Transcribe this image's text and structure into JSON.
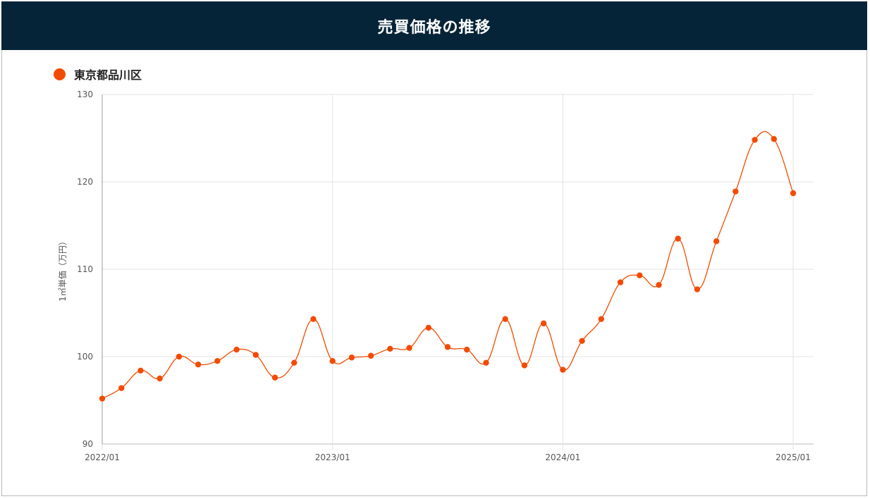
{
  "header": {
    "title": "売買価格の推移"
  },
  "colors": {
    "header_bg": "#062437",
    "series": "#f24b00"
  },
  "chart_data": {
    "type": "line",
    "title": "売買価格の推移",
    "ylabel": "1㎡単価（万円）",
    "xlabel": "",
    "ylim": [
      90,
      130
    ],
    "yticks": [
      90,
      100,
      110,
      120,
      130
    ],
    "xticks": [
      {
        "index": 0,
        "label": "2022/01"
      },
      {
        "index": 12,
        "label": "2023/01"
      },
      {
        "index": 24,
        "label": "2024/01"
      },
      {
        "index": 36,
        "label": "2025/01"
      }
    ],
    "grid": true,
    "legend_position": "top-left",
    "x": [
      "2022/01",
      "2022/02",
      "2022/03",
      "2022/04",
      "2022/05",
      "2022/06",
      "2022/07",
      "2022/08",
      "2022/09",
      "2022/10",
      "2022/11",
      "2022/12",
      "2023/01",
      "2023/02",
      "2023/03",
      "2023/04",
      "2023/05",
      "2023/06",
      "2023/07",
      "2023/08",
      "2023/09",
      "2023/10",
      "2023/11",
      "2023/12",
      "2024/01",
      "2024/02",
      "2024/03",
      "2024/04",
      "2024/05",
      "2024/06",
      "2024/07",
      "2024/08",
      "2024/09",
      "2024/10",
      "2024/11",
      "2024/12",
      "2025/01"
    ],
    "series": [
      {
        "name": "東京都品川区",
        "values": [
          95.2,
          96.4,
          98.4,
          97.5,
          100.0,
          99.1,
          99.5,
          100.8,
          100.2,
          97.6,
          99.3,
          104.3,
          99.5,
          99.9,
          100.1,
          100.9,
          101.0,
          103.3,
          101.1,
          100.8,
          99.3,
          104.3,
          99.0,
          103.8,
          98.5,
          101.8,
          104.3,
          108.5,
          109.3,
          108.2,
          113.5,
          107.7,
          113.2,
          118.9,
          124.8,
          124.9,
          118.7
        ]
      }
    ]
  }
}
